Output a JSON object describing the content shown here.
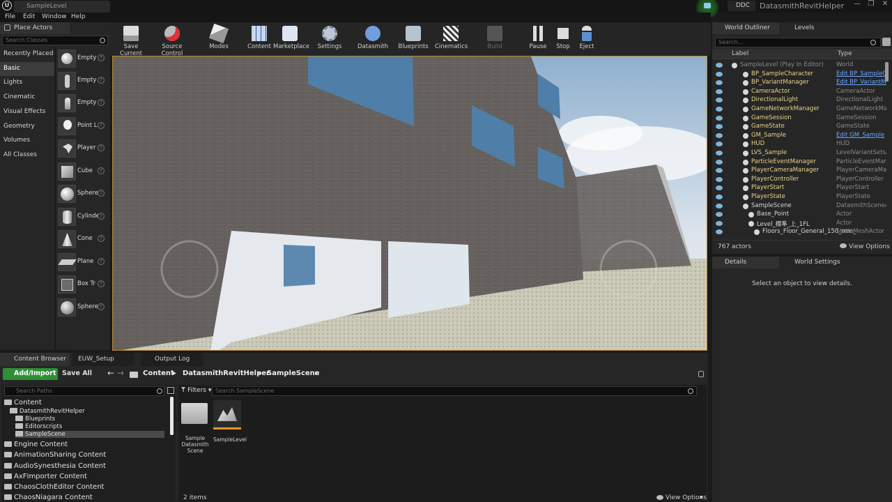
{
  "title_bar": {
    "logo": "U",
    "document_tab": "SampleLevel",
    "ddc": "DDC",
    "project_name": "DatasmithRevitHelper",
    "window_controls": [
      "—",
      "❐",
      "✕"
    ]
  },
  "menu": [
    "File",
    "Edit",
    "Window",
    "Help"
  ],
  "place_actors": {
    "tab": "Place Actors",
    "search_placeholder": "Search Classes",
    "categories": [
      "Recently Placed",
      "Basic",
      "Lights",
      "Cinematic",
      "Visual Effects",
      "Geometry",
      "Volumes",
      "All Classes"
    ],
    "selected_category": "Basic",
    "items": [
      "Empty",
      "Empty",
      "Empty",
      "Point L",
      "Player",
      "Cube",
      "Sphere",
      "Cylinde",
      "Cone",
      "Plane",
      "Box Tr",
      "Sphere"
    ],
    "help": "?"
  },
  "toolbar": {
    "buttons": [
      "Save Current",
      "Source Control",
      "Modes",
      "Content",
      "Marketplace",
      "Settings",
      "Datasmith",
      "Blueprints",
      "Cinematics",
      "Build",
      "Pause",
      "Stop",
      "Eject"
    ]
  },
  "world_outliner": {
    "tabs": [
      "World Outliner",
      "Levels"
    ],
    "search_placeholder": "Search...",
    "columns": [
      "Label",
      "Type"
    ],
    "rows": [
      {
        "label": "SampleLevel (Play In Editor)",
        "type": "World"
      },
      {
        "label": "BP_SampleCharacter",
        "type": "Edit BP_SampleC"
      },
      {
        "label": "BP_VariantManager",
        "type": "Edit BP_VariantM"
      },
      {
        "label": "CameraActor",
        "type": "CameraActor"
      },
      {
        "label": "DirectionalLight",
        "type": "DirectionalLight"
      },
      {
        "label": "GameNetworkManager",
        "type": "GameNetworkMan"
      },
      {
        "label": "GameSession",
        "type": "GameSession"
      },
      {
        "label": "GameState",
        "type": "GameState"
      },
      {
        "label": "GM_Sample",
        "type": "Edit GM_Sample"
      },
      {
        "label": "HUD",
        "type": "HUD"
      },
      {
        "label": "LVS_Sample",
        "type": "LevelVariantSetsA"
      },
      {
        "label": "ParticleEventManager",
        "type": "ParticleEventMana"
      },
      {
        "label": "PlayerCameraManager",
        "type": "PlayerCameraMan"
      },
      {
        "label": "PlayerController",
        "type": "PlayerController"
      },
      {
        "label": "PlayerStart",
        "type": "PlayerStart"
      },
      {
        "label": "PlayerState",
        "type": "PlayerState"
      },
      {
        "label": "SampleScene",
        "type": "DatasmithSceneAc"
      },
      {
        "label": "Base_Point",
        "type": "Actor"
      },
      {
        "label": "Level_標準_上_1FL",
        "type": "Actor"
      },
      {
        "label": "Floors_Floor_General_150_mm_",
        "type": "StaticMeshActor"
      }
    ],
    "actor_count": "767 actors",
    "view_options": "View Options"
  },
  "details": {
    "tabs": [
      "Details",
      "World Settings"
    ],
    "empty_message": "Select an object to view details."
  },
  "content_browser": {
    "tabs": [
      "Content Browser",
      "EUW_Setup",
      "Output Log"
    ],
    "add_import": "Add/Import",
    "save_all": "Save All",
    "breadcrumb": [
      "Content",
      "DatasmithRevitHelper",
      "SampleScene"
    ],
    "search_paths_placeholder": "Search Paths",
    "filters": "Filters",
    "search_placeholder": "Search SampleScene",
    "tree": [
      {
        "label": "Content",
        "depth": 0
      },
      {
        "label": "DatasmithRevitHelper",
        "depth": 1
      },
      {
        "label": "Blueprints",
        "depth": 2
      },
      {
        "label": "Editorscripts",
        "depth": 2
      },
      {
        "label": "SampleScene",
        "depth": 2
      },
      {
        "label": "Engine Content",
        "depth": 0
      },
      {
        "label": "AnimationSharing Content",
        "depth": 0
      },
      {
        "label": "AudioSynesthesia Content",
        "depth": 0
      },
      {
        "label": "AxFImporter Content",
        "depth": 0
      },
      {
        "label": "ChaosClothEditor Content",
        "depth": 0
      },
      {
        "label": "ChaosNiagara Content",
        "depth": 0
      }
    ],
    "assets": [
      "Sample Datasmith Scene",
      "SampleLevel"
    ],
    "item_count": "2 items",
    "view_options": "View Options"
  }
}
